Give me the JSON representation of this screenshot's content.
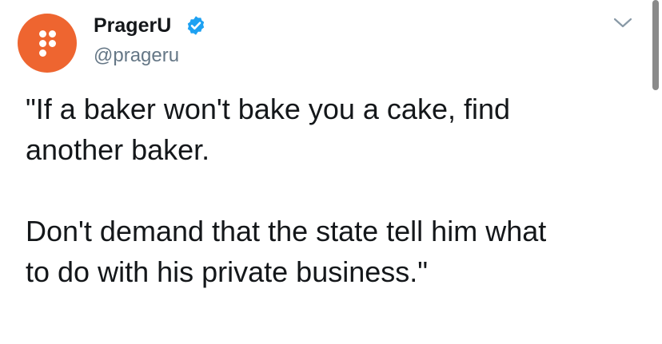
{
  "user": {
    "display_name": "PragerU",
    "handle": "@prageru",
    "avatar_color": "#ee6530",
    "verified_color": "#1da1f2",
    "avatar_icon": "prageru-logo-icon",
    "verified_icon": "verified-badge-icon"
  },
  "menu": {
    "icon": "chevron-down-icon"
  },
  "tweet": {
    "lines": [
      "\"If a baker won't bake you a cake, find",
      "another baker.",
      "Don't demand that the state tell him what",
      "to do with his private business.\""
    ]
  }
}
